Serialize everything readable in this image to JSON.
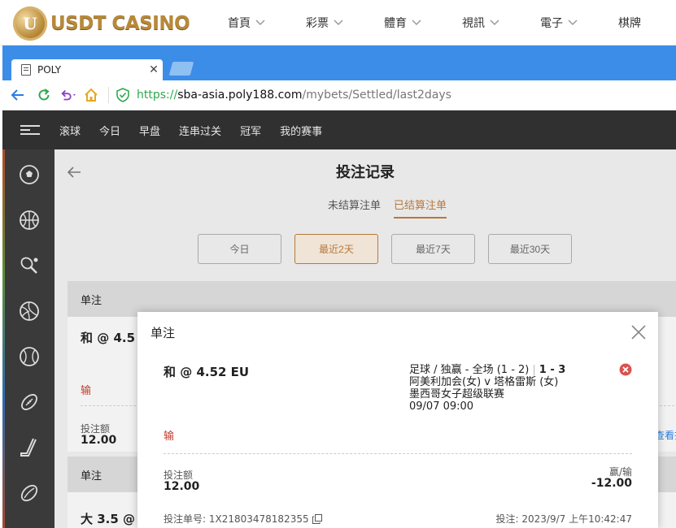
{
  "site": {
    "logo_text": "USDT CASINO",
    "nav": [
      "首頁",
      "彩票",
      "體育",
      "視訊",
      "電子",
      "棋牌"
    ]
  },
  "browser": {
    "tab_title": "POLY",
    "url_scheme": "https://",
    "url_host": "sba-asia.poly188.com",
    "url_path": "/mybets/Settled/last2days"
  },
  "app": {
    "nav": [
      "滚球",
      "今日",
      "早盘",
      "连串过关",
      "冠军",
      "我的赛事"
    ],
    "sidebar_icons": [
      "soccer-icon",
      "basketball-icon",
      "tennis-icon",
      "volleyball-icon",
      "baseball-icon",
      "american-football-icon",
      "hockey-icon",
      "rugby-icon"
    ],
    "page_title": "投注记录",
    "subtabs": [
      "未结算注单",
      "已结算注单"
    ],
    "active_subtab": "已结算注单",
    "ranges": [
      "今日",
      "最近2天",
      "最近7天",
      "最近30天"
    ],
    "active_range": "最近2天",
    "bg_bet1": {
      "header": "单注",
      "odds": "和 @ 4.5",
      "result": "输",
      "stake_label": "投注额",
      "stake": "12.00",
      "link": "查看投"
    },
    "bg_bet2": {
      "header": "单注",
      "odds": "大 3.5 @"
    }
  },
  "modal": {
    "title": "单注",
    "odds": "和 @ 4.52 EU",
    "market": "足球 / 独赢 - 全场 (1 - 2)",
    "score": "1 - 3",
    "teams": "阿美利加会(女) v 塔格雷斯 (女)",
    "league": "墨西哥女子超级联赛",
    "match_time": "09/07 09:00",
    "result": "输",
    "stake_label": "投注额",
    "stake": "12.00",
    "winlose_label": "赢/输",
    "winlose": "-12.00",
    "bet_id": "投注单号: 1X21803478182355",
    "bet_time": "投注: 2023/9/7 上午10:42:47"
  },
  "colors": {
    "accent": "#b8793b",
    "lose": "#c23a2a",
    "browser_blue": "#3c8de8",
    "cancel": "#d9534f"
  }
}
